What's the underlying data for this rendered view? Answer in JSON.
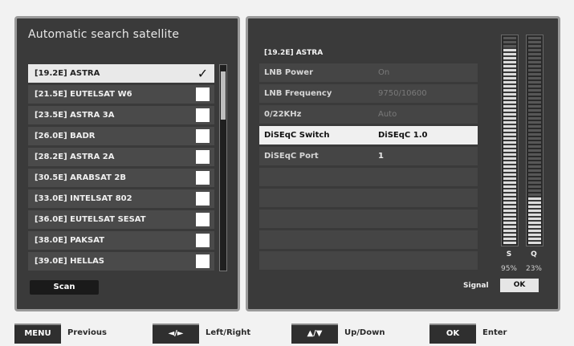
{
  "left_panel": {
    "title": "Automatic search satellite",
    "satellites": [
      {
        "name": "[19.2E] ASTRA",
        "checked": true
      },
      {
        "name": "[21.5E] EUTELSAT W6",
        "checked": false
      },
      {
        "name": "[23.5E] ASTRA 3A",
        "checked": false
      },
      {
        "name": "[26.0E] BADR",
        "checked": false
      },
      {
        "name": "[28.2E] ASTRA 2A",
        "checked": false
      },
      {
        "name": "[30.5E] ARABSAT 2B",
        "checked": false
      },
      {
        "name": "[33.0E] INTELSAT 802",
        "checked": false
      },
      {
        "name": "[36.0E] EUTELSAT SESAT",
        "checked": false
      },
      {
        "name": "[38.0E] PAKSAT",
        "checked": false
      },
      {
        "name": "[39.0E] HELLAS",
        "checked": false
      }
    ],
    "check_mark": "✓",
    "scan_label": "Scan"
  },
  "right_panel": {
    "selected_satellite": "[19.2E] ASTRA",
    "params": [
      {
        "label": "LNB Power",
        "value": "On"
      },
      {
        "label": "LNB Frequency",
        "value": "9750/10600"
      },
      {
        "label": "0/22KHz",
        "value": "Auto"
      },
      {
        "label": "DiSEqC Switch",
        "value": "DiSEqC 1.0"
      },
      {
        "label": "DiSEqC Port",
        "value": "1"
      },
      {
        "label": "",
        "value": ""
      },
      {
        "label": "",
        "value": ""
      },
      {
        "label": "",
        "value": ""
      },
      {
        "label": "",
        "value": ""
      },
      {
        "label": "",
        "value": ""
      }
    ],
    "meters": {
      "s": {
        "label": "S",
        "percent_text": "95%",
        "level": 0.95
      },
      "q": {
        "label": "Q",
        "percent_text": "23%",
        "level": 0.23
      }
    },
    "signal_label": "Signal",
    "signal_status": "OK"
  },
  "footer": {
    "buttons": [
      {
        "key": "MENU",
        "action": "Previous"
      },
      {
        "key": "◄/►",
        "action": "Left/Right"
      },
      {
        "key": "▲/▼",
        "action": "Up/Down"
      },
      {
        "key": "OK",
        "action": "Enter"
      }
    ]
  },
  "colors": {
    "panel_bg": "#3a3a3a",
    "highlight_row": "#e9e9e9",
    "row_bg": "#4a4a4a"
  }
}
